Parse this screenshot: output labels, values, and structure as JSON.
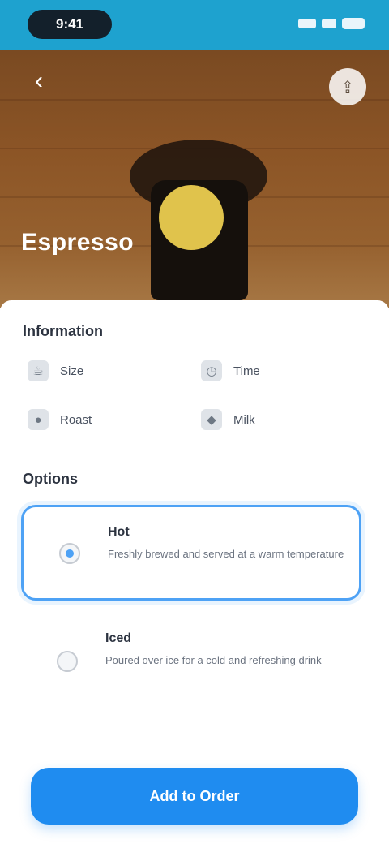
{
  "status_bar": {
    "time": "9:41",
    "icons": [
      "signal-icon",
      "wifi-icon",
      "battery-icon"
    ]
  },
  "hero": {
    "nav_title": "",
    "back_icon": "chevron-left-icon",
    "share_icon": "share-icon",
    "title": "Espresso",
    "subtitle": ""
  },
  "details": {
    "heading": "Information",
    "items": [
      {
        "icon": "cup-icon",
        "label": "Size"
      },
      {
        "icon": "clock-icon",
        "label": "Time"
      },
      {
        "icon": "bean-icon",
        "label": "Roast"
      },
      {
        "icon": "drop-icon",
        "label": "Milk"
      }
    ]
  },
  "options": {
    "heading": "Options",
    "items": [
      {
        "title": "Hot",
        "description": "Freshly brewed and served at a warm temperature",
        "selected": true
      },
      {
        "title": "Iced",
        "description": "Poured over ice for a cold and refreshing drink",
        "selected": false
      }
    ]
  },
  "cta": {
    "label": "Add to Order"
  },
  "colors": {
    "accent": "#1f8cf0",
    "status_bar": "#1ea2cf",
    "selected_border": "#4ea2f5"
  }
}
